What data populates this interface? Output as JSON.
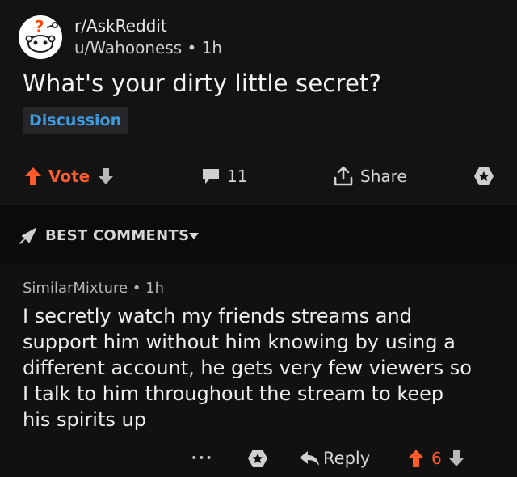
{
  "post": {
    "subreddit": "r/AskReddit",
    "author": "u/Wahooness",
    "separator": "•",
    "time": "1h",
    "title": "What's your dirty little secret?",
    "flair": "Discussion",
    "vote_label": "Vote",
    "comment_count": "11",
    "share_label": "Share"
  },
  "sort": {
    "label": "BEST COMMENTS"
  },
  "comment": {
    "author": "SimilarMixture",
    "separator": "•",
    "time": "1h",
    "body_lines": [
      "I secretly watch my friends streams and",
      "support him without him knowing by using a",
      "different account, he gets very few viewers so",
      "I talk to him throughout the stream to keep",
      "his spirits up"
    ],
    "more_label": "•••",
    "reply_label": "Reply",
    "score": "6"
  },
  "colors": {
    "accent_orange": "#ff5a2c",
    "flair_blue": "#3d9bde",
    "background": "#131314"
  },
  "icons": [
    "reddit-snoo-icon",
    "upvote-icon",
    "downvote-icon",
    "comment-icon",
    "share-icon",
    "award-icon",
    "rocket-icon",
    "chevron-down-icon",
    "reply-icon",
    "more-icon"
  ]
}
